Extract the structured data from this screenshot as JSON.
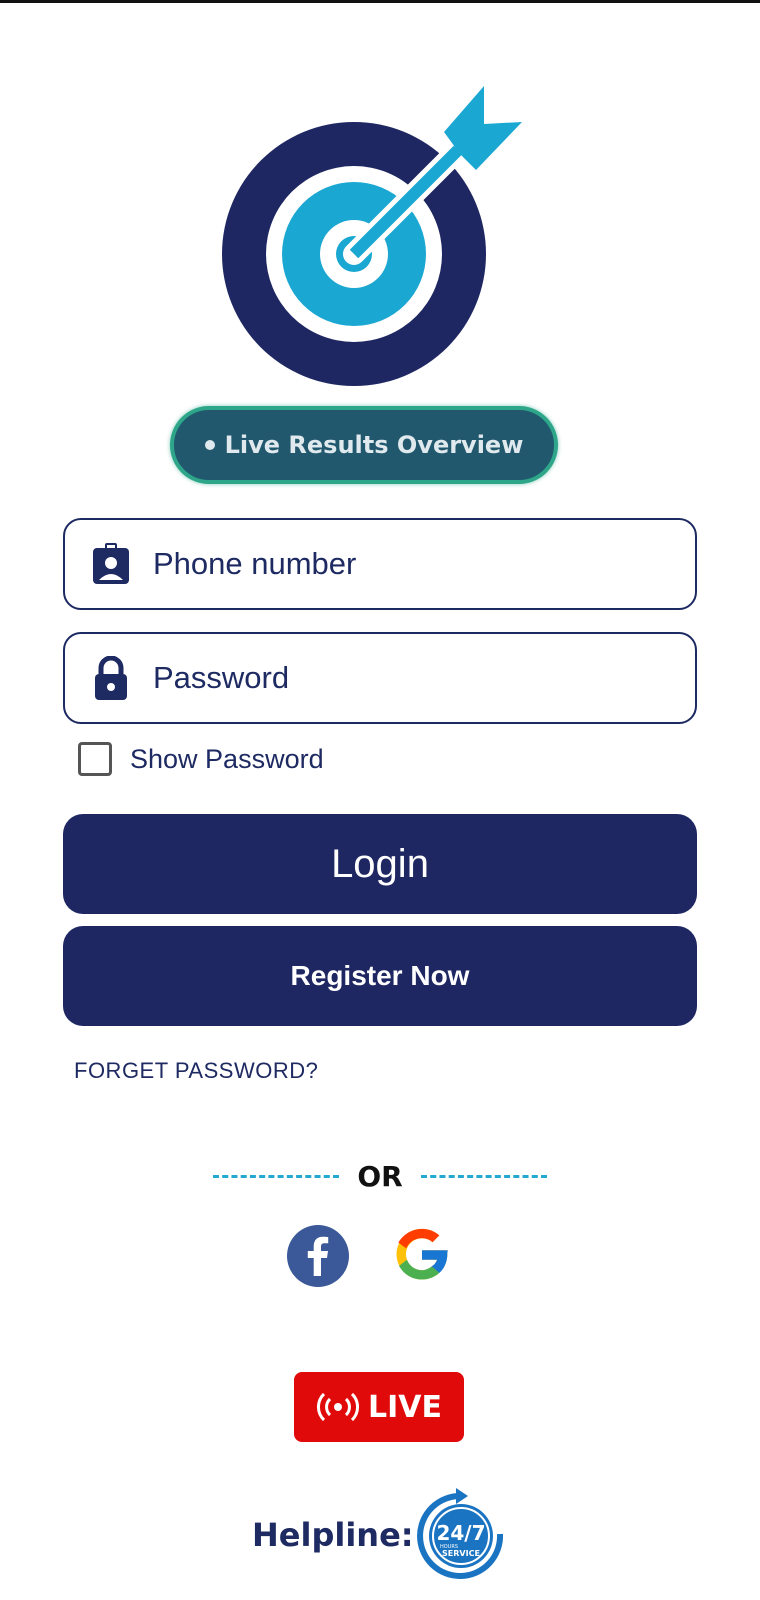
{
  "brand": {
    "logo_icon": "target-arrow-logo",
    "dark_color": "#1e2762",
    "accent_color": "#1aa7d2"
  },
  "badge": {
    "label": "Live Results Overview"
  },
  "form": {
    "phone_placeholder": "Phone number",
    "phone_icon": "contact-badge-icon",
    "password_placeholder": "Password",
    "password_icon": "lock-icon",
    "show_password_label": "Show Password",
    "show_password_checked": false
  },
  "actions": {
    "login_label": "Login",
    "register_label": "Register Now",
    "forget_password_label": "FORGET PASSWORD?"
  },
  "divider": {
    "or_label": "OR"
  },
  "social": {
    "facebook_icon": "facebook-icon",
    "facebook_color": "#3b5998",
    "google_icon": "google-icon"
  },
  "live": {
    "label": "LIVE",
    "color": "#e10a0a"
  },
  "helpline": {
    "label": "Helpline:",
    "icon_top": "24/7",
    "icon_middle": "HOURS",
    "icon_bottom": "SERVICE"
  }
}
